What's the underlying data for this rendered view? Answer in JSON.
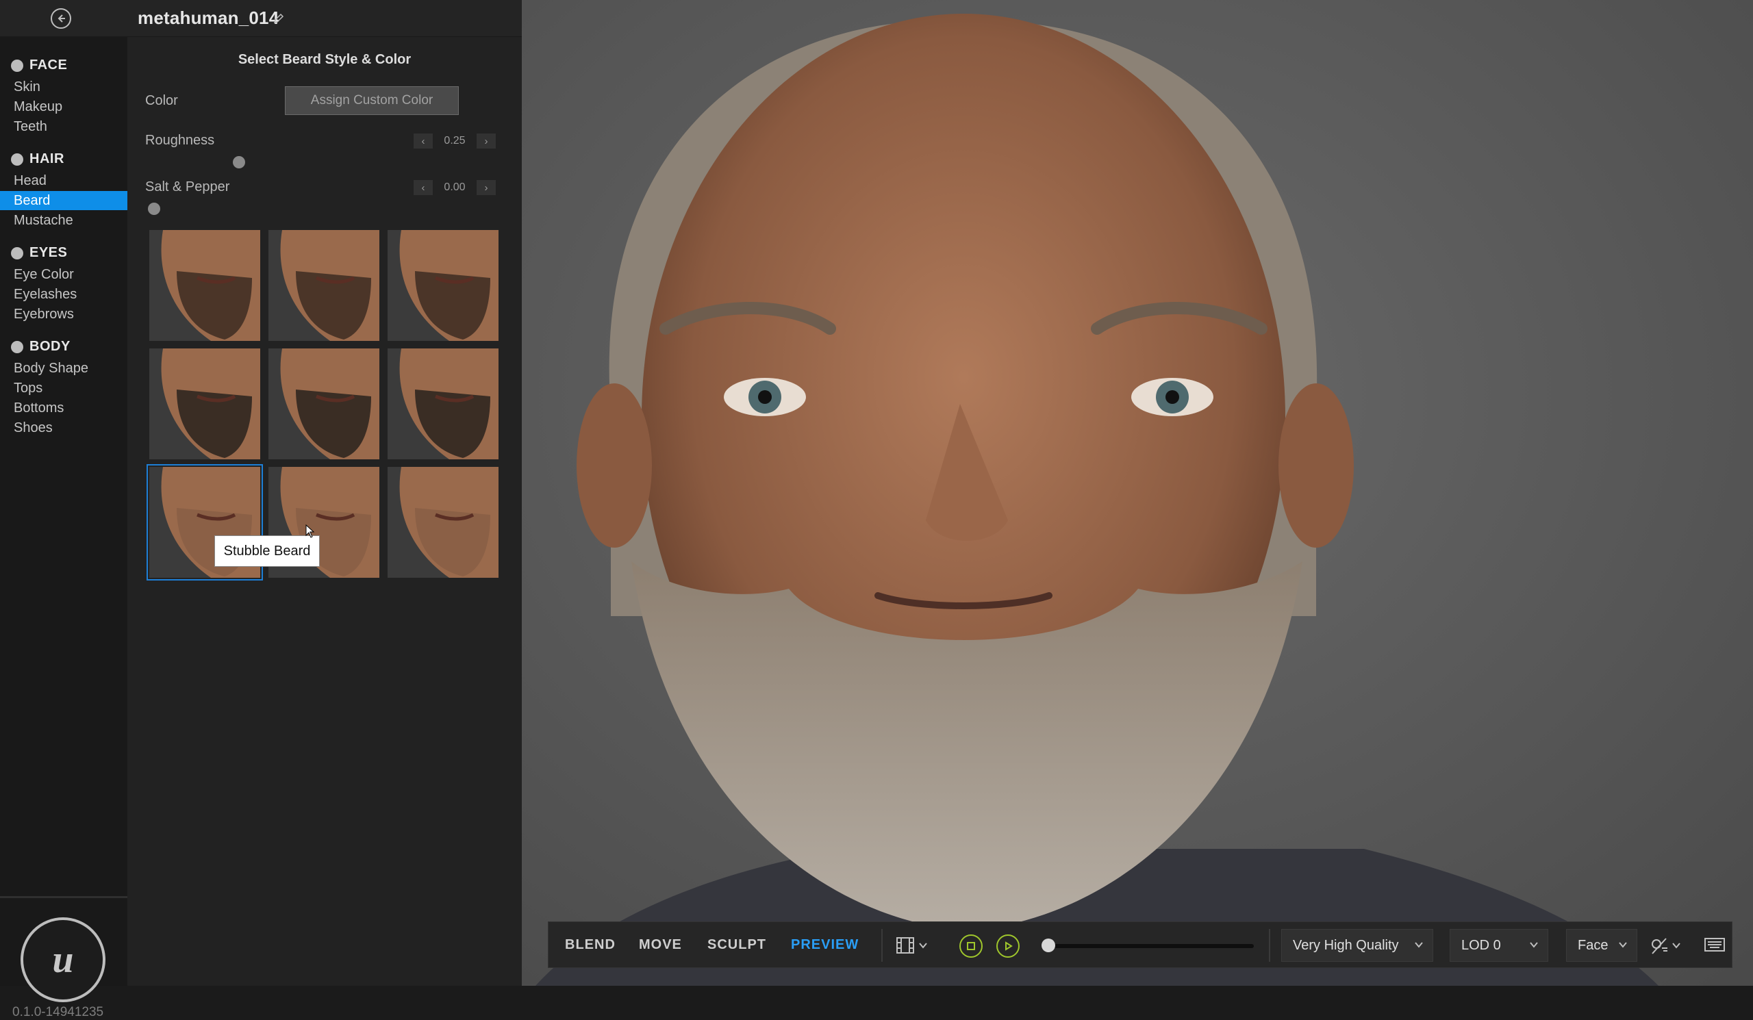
{
  "header": {
    "title": "metahuman_014"
  },
  "sidebar": {
    "sections": [
      {
        "title": "FACE",
        "icon": "face-icon",
        "items": [
          "Skin",
          "Makeup",
          "Teeth"
        ]
      },
      {
        "title": "HAIR",
        "icon": "hair-icon",
        "items": [
          "Head",
          "Beard",
          "Mustache"
        ]
      },
      {
        "title": "EYES",
        "icon": "eye-icon",
        "items": [
          "Eye Color",
          "Eyelashes",
          "Eyebrows"
        ]
      },
      {
        "title": "BODY",
        "icon": "body-icon",
        "items": [
          "Body Shape",
          "Tops",
          "Bottoms",
          "Shoes"
        ]
      }
    ],
    "active_item": "Beard",
    "version": "0.1.0-14941235"
  },
  "panel": {
    "title": "Select Beard Style & Color",
    "color_label": "Color",
    "color_button": "Assign Custom Color",
    "roughness_label": "Roughness",
    "roughness_value": "0.25",
    "roughness_fraction": 0.25,
    "salt_pepper_label": "Salt & Pepper",
    "salt_pepper_value": "0.00",
    "salt_pepper_fraction": 0.0,
    "tooltip": "Stubble Beard",
    "thumbnails": [
      {
        "style": "full-beard-1"
      },
      {
        "style": "goatee-1"
      },
      {
        "style": "chinstrap-1"
      },
      {
        "style": "full-beard-2"
      },
      {
        "style": "goatee-2"
      },
      {
        "style": "full-beard-3"
      },
      {
        "style": "stubble",
        "selected": true
      },
      {
        "style": "stubble-2"
      },
      {
        "style": "light-stubble"
      }
    ]
  },
  "toolbar": {
    "modes": [
      "BLEND",
      "MOVE",
      "SCULPT",
      "PREVIEW"
    ],
    "active_mode": "PREVIEW",
    "quality": "Very High Quality",
    "lod": "LOD 0",
    "camera": "Face",
    "playback_fraction": 0.0
  },
  "colors": {
    "accent": "#0e8ee8",
    "preview_active": "#2a9ef5",
    "play_ring": "#9fc62c"
  }
}
